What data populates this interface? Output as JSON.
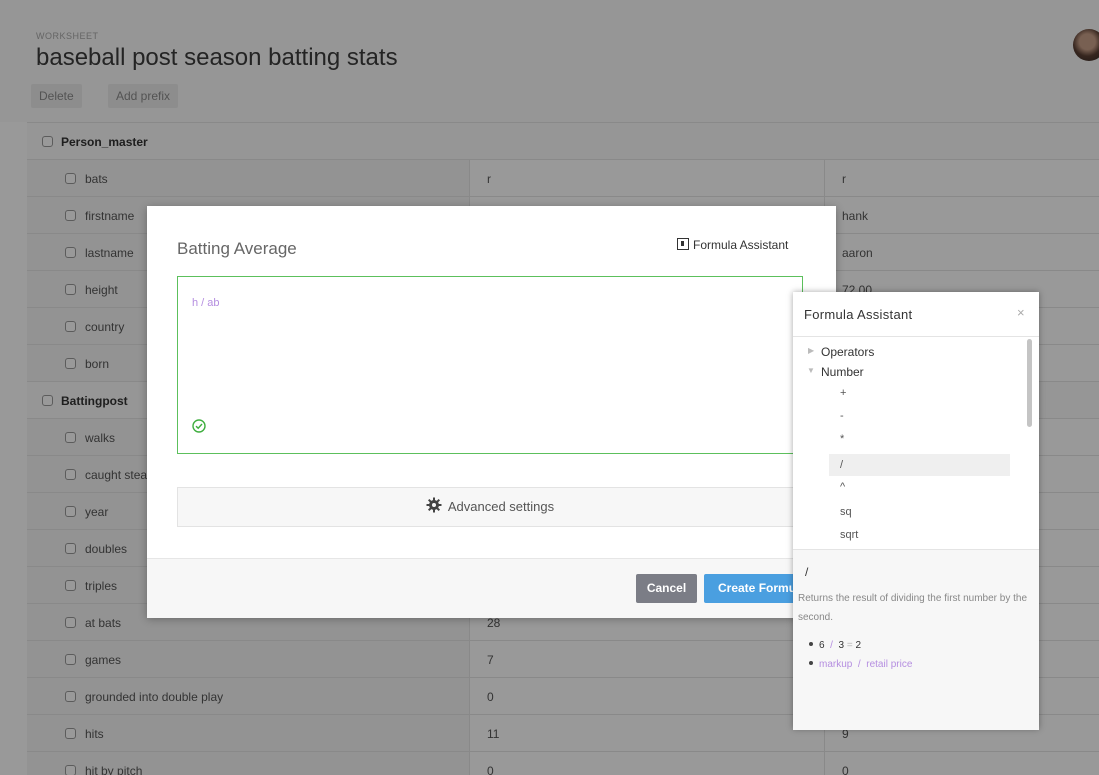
{
  "worksheet": {
    "label": "WORKSHEET",
    "title": "baseball post season batting stats",
    "delete_label": "Delete",
    "add_prefix_label": "Add prefix"
  },
  "table": {
    "groups": [
      {
        "name": "Person_master"
      },
      {
        "name": "Battingpost"
      }
    ],
    "person_rows": [
      {
        "name": "bats",
        "v1": "r",
        "v2": "r"
      },
      {
        "name": "firstname",
        "v1": "",
        "v2": "hank"
      },
      {
        "name": "lastname",
        "v1": "",
        "v2": "aaron"
      },
      {
        "name": "height",
        "v1": "",
        "v2": "72.00"
      },
      {
        "name": "country",
        "v1": "",
        "v2": ""
      },
      {
        "name": "born",
        "v1": "",
        "v2": ""
      }
    ],
    "batting_rows": [
      {
        "name": "walks",
        "v1": "",
        "v2": ""
      },
      {
        "name": "caught stea",
        "v1": "",
        "v2": ""
      },
      {
        "name": "year",
        "v1": "",
        "v2": ""
      },
      {
        "name": "doubles",
        "v1": "",
        "v2": ""
      },
      {
        "name": "triples",
        "v1": "",
        "v2": ""
      },
      {
        "name": "at bats",
        "v1": "28",
        "v2": ""
      },
      {
        "name": "games",
        "v1": "7",
        "v2": ""
      },
      {
        "name": "grounded into double play",
        "v1": "0",
        "v2": ""
      },
      {
        "name": "hits",
        "v1": "11",
        "v2": "9"
      },
      {
        "name": "hit by pitch",
        "v1": "0",
        "v2": "0"
      }
    ]
  },
  "modal": {
    "title": "Batting Average",
    "assistant_link": "Formula Assistant",
    "formula": "h / ab",
    "advanced_label": "Advanced settings",
    "cancel_label": "Cancel",
    "create_label": "Create Formula"
  },
  "assistant": {
    "title": "Formula Assistant",
    "close": "×",
    "categories": [
      {
        "label": "Operators",
        "expanded": false
      },
      {
        "label": "Number",
        "expanded": true
      }
    ],
    "operators": [
      "+",
      "-",
      "*",
      "/",
      "^",
      "sq",
      "sqrt"
    ],
    "selected_operator": "/",
    "detail": {
      "operator": "/",
      "description": "Returns the result of dividing the first number by the second.",
      "example1": {
        "left": "6",
        "op": "/",
        "right": "3",
        "eq": "=",
        "result": "2"
      },
      "example2": {
        "left": "markup",
        "op": "/",
        "right": "retail price"
      }
    }
  },
  "colors": {
    "formula_text": "#b58ee0",
    "editor_border_valid": "#5cc05c",
    "create_button": "#4a9fe0",
    "cancel_button": "#7b7d86",
    "valid_icon": "#3fae3f"
  },
  "icons": {
    "assistant_link": "formula-assistant-icon",
    "valid": "check-circle-icon",
    "advanced": "gear-icon",
    "close": "close-icon"
  }
}
